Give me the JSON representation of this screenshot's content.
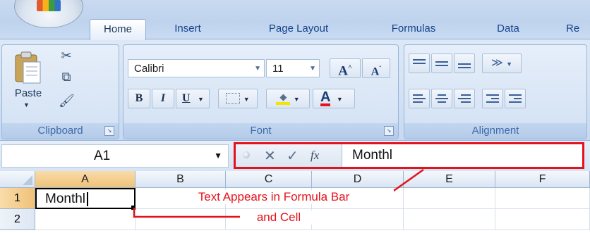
{
  "ribbon": {
    "tabs": [
      "Home",
      "Insert",
      "Page Layout",
      "Formulas",
      "Data",
      "Re"
    ],
    "active_tab": "Home",
    "groups": {
      "clipboard": {
        "label": "Clipboard",
        "paste_label": "Paste"
      },
      "font": {
        "label": "Font",
        "font_name": "Calibri",
        "font_size": "11",
        "bold": "B",
        "italic": "I",
        "underline": "U",
        "font_color_glyph": "A"
      },
      "alignment": {
        "label": "Alignment"
      }
    }
  },
  "formula_bar": {
    "name_box": "A1",
    "content": "Monthl"
  },
  "sheet": {
    "columns": [
      "A",
      "B",
      "C",
      "D",
      "E",
      "F"
    ],
    "rows": [
      "1",
      "2"
    ],
    "active_cell_value": "Monthl",
    "selected_column": "A",
    "selected_row": "1"
  },
  "annotation": {
    "line1": "Text Appears in Formula Bar",
    "line2": "and Cell"
  },
  "colors": {
    "annotation_red": "#e3121b",
    "font_color_underline": "#e3121b",
    "header_highlight": "#f0c278"
  }
}
